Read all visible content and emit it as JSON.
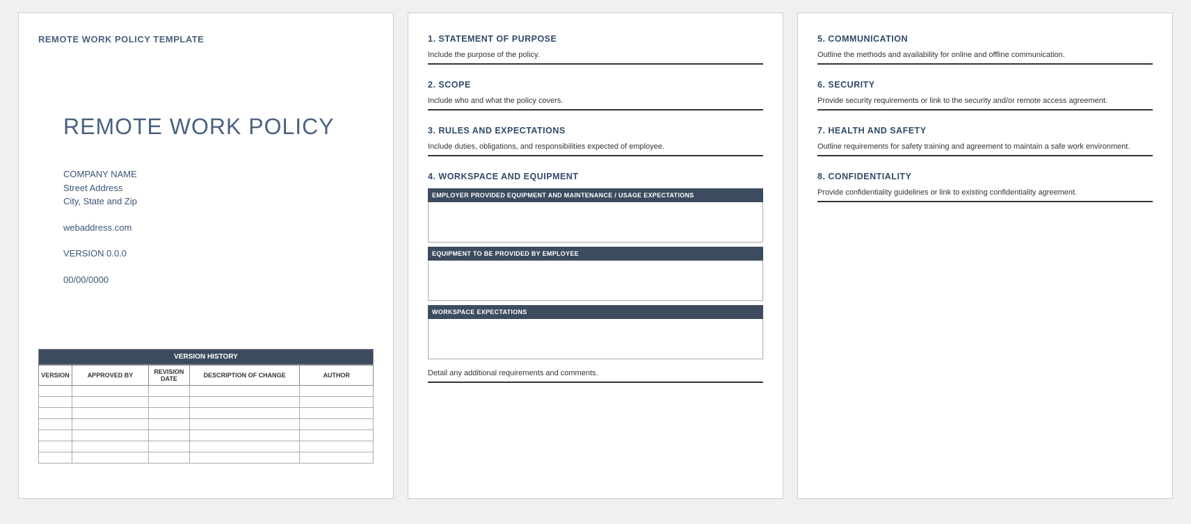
{
  "page1": {
    "header": "REMOTE WORK POLICY TEMPLATE",
    "title": "REMOTE WORK POLICY",
    "company_name": "COMPANY NAME",
    "street": "Street Address",
    "city": "City, State and Zip",
    "web": "webaddress.com",
    "version": "VERSION 0.0.0",
    "date": "00/00/0000",
    "version_history_title": "VERSION HISTORY",
    "columns": {
      "version": "VERSION",
      "approved": "APPROVED BY",
      "revdate": "REVISION DATE",
      "desc": "DESCRIPTION OF CHANGE",
      "author": "AUTHOR"
    }
  },
  "page2": {
    "s1_head": "1.  STATEMENT OF PURPOSE",
    "s1_text": "Include the purpose of the policy.",
    "s2_head": "2.  SCOPE",
    "s2_text": "Include who and what the policy covers.",
    "s3_head": "3.  RULES AND EXPECTATIONS",
    "s3_text": "Include duties, obligations, and responsibilities expected of employee.",
    "s4_head": "4.  WORKSPACE AND EQUIPMENT",
    "box1": "EMPLOYER PROVIDED EQUIPMENT AND MAINTENANCE / USAGE EXPECTATIONS",
    "box2": "EQUIPMENT TO BE PROVIDED BY EMPLOYEE",
    "box3": "WORKSPACE EXPECTATIONS",
    "s4_text": "Detail any additional requirements and comments."
  },
  "page3": {
    "s5_head": "5.  COMMUNICATION",
    "s5_text": "Outline the methods and availability for online and offline communication.",
    "s6_head": "6.  SECURITY",
    "s6_text": "Provide security requirements or link to the security and/or remote access agreement.",
    "s7_head": "7.  HEALTH AND SAFETY",
    "s7_text": "Outline requirements for safety training and agreement to maintain a safe work environment.",
    "s8_head": "8.  CONFIDENTIALITY",
    "s8_text": "Provide confidentiality guidelines or link to existing confidentiality agreement."
  }
}
